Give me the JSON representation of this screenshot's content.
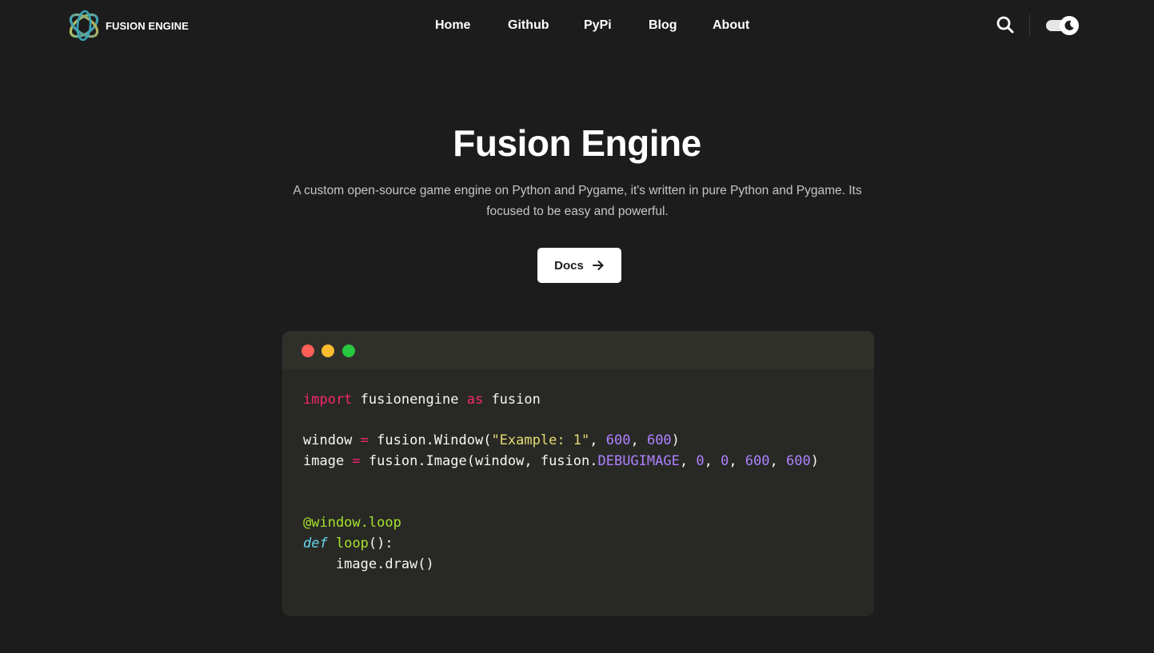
{
  "colors": {
    "background": "#1c1c1c",
    "code_bg": "#282925",
    "code_header_bg": "#30302b",
    "dot_red": "#ff5f57",
    "dot_yellow": "#febc2e",
    "dot_green": "#28c840"
  },
  "brand": {
    "name": "FUSION ENGINE",
    "logo_icon": "fusion-engine-logo-icon"
  },
  "nav": {
    "links": [
      {
        "label": "Home"
      },
      {
        "label": "Github"
      },
      {
        "label": "PyPi"
      },
      {
        "label": "Blog"
      },
      {
        "label": "About"
      }
    ],
    "search_icon": "search-icon",
    "theme_toggle_icon": "moon-icon",
    "dark_mode": true
  },
  "hero": {
    "title": "Fusion Engine",
    "subtitle": "A custom open-source game engine on Python and Pygame, it's written in pure Python and Pygame. Its focused to be easy and powerful.",
    "docs_button": {
      "label": "Docs",
      "icon": "arrow-right-icon"
    }
  },
  "code_window": {
    "window_controls": [
      "close-dot",
      "minimize-dot",
      "maximize-dot"
    ],
    "lines": [
      [
        {
          "t": "import",
          "c": "kw"
        },
        {
          "t": " fusionengine ",
          "c": ""
        },
        {
          "t": "as",
          "c": "kw"
        },
        {
          "t": " fusion",
          "c": ""
        }
      ],
      [],
      [
        {
          "t": "window ",
          "c": ""
        },
        {
          "t": "=",
          "c": "kw"
        },
        {
          "t": " fusion.Window(",
          "c": ""
        },
        {
          "t": "\"Example: 1\"",
          "c": "str"
        },
        {
          "t": ", ",
          "c": ""
        },
        {
          "t": "600",
          "c": "num"
        },
        {
          "t": ", ",
          "c": ""
        },
        {
          "t": "600",
          "c": "num"
        },
        {
          "t": ")",
          "c": ""
        }
      ],
      [
        {
          "t": "image ",
          "c": ""
        },
        {
          "t": "=",
          "c": "kw"
        },
        {
          "t": " fusion.Image(window, fusion.",
          "c": ""
        },
        {
          "t": "DEBUGIMAGE",
          "c": "const"
        },
        {
          "t": ", ",
          "c": ""
        },
        {
          "t": "0",
          "c": "num"
        },
        {
          "t": ", ",
          "c": ""
        },
        {
          "t": "0",
          "c": "num"
        },
        {
          "t": ", ",
          "c": ""
        },
        {
          "t": "600",
          "c": "num"
        },
        {
          "t": ", ",
          "c": ""
        },
        {
          "t": "600",
          "c": "num"
        },
        {
          "t": ")",
          "c": ""
        }
      ],
      [],
      [],
      [
        {
          "t": "@window.loop",
          "c": "deco"
        }
      ],
      [
        {
          "t": "def",
          "c": "def"
        },
        {
          "t": " ",
          "c": ""
        },
        {
          "t": "loop",
          "c": "fn"
        },
        {
          "t": "():",
          "c": ""
        }
      ],
      [
        {
          "t": "    image.draw()",
          "c": ""
        }
      ]
    ]
  }
}
